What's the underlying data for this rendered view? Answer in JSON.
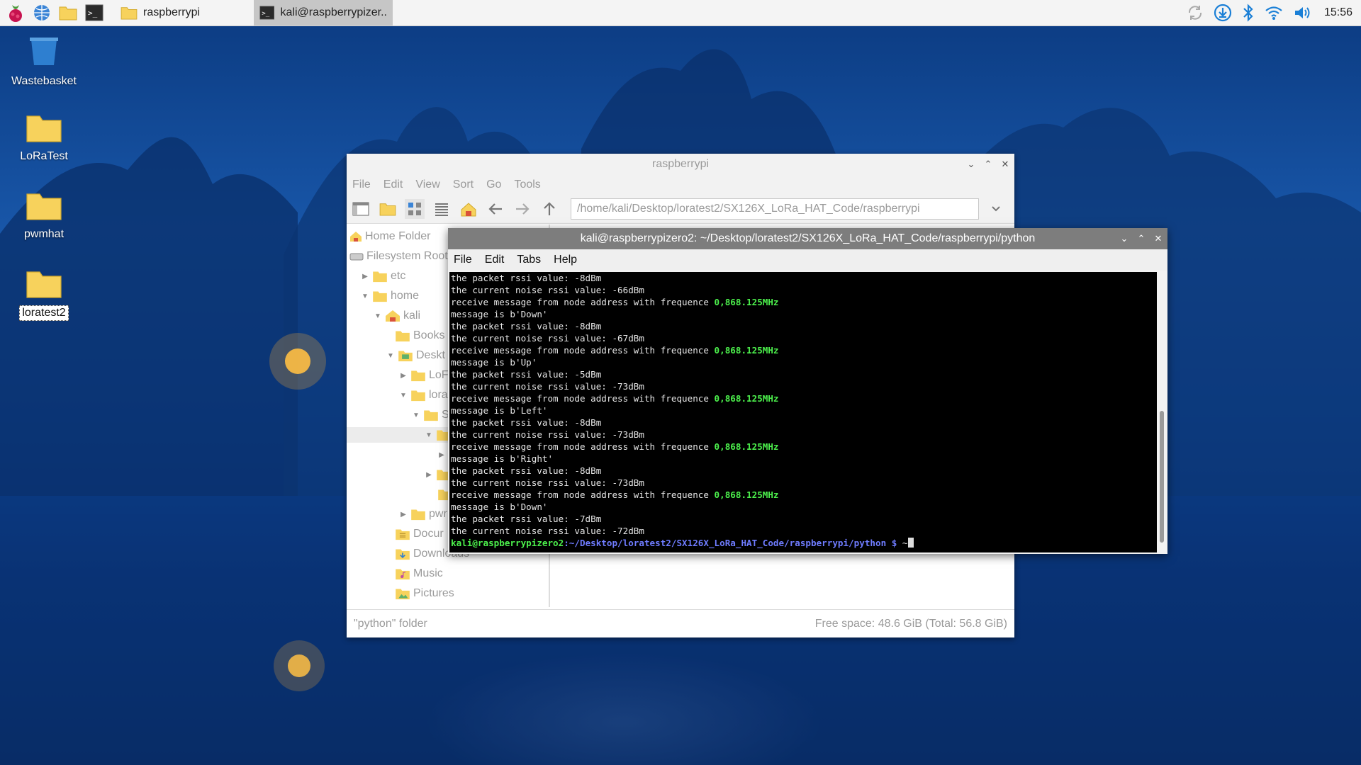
{
  "taskbar": {
    "tasks": [
      {
        "label": "raspberrypi",
        "active": false
      },
      {
        "label": "kali@raspberrypizer..",
        "active": true
      }
    ],
    "clock": "15:56"
  },
  "desktop": {
    "icons": [
      {
        "label": "Wastebasket"
      },
      {
        "label": "LoRaTest"
      },
      {
        "label": "pwmhat"
      },
      {
        "label": "loratest2"
      }
    ]
  },
  "file_manager": {
    "title": "raspberrypi",
    "menu": [
      "File",
      "Edit",
      "View",
      "Sort",
      "Go",
      "Tools"
    ],
    "path": "/home/kali/Desktop/loratest2/SX126X_LoRa_HAT_Code/raspberrypi",
    "places": [
      "Home Folder",
      "Filesystem Root"
    ],
    "tree": [
      "etc",
      "home",
      "kali",
      "Books",
      "Deskt",
      "LoF",
      "lora",
      "S",
      "pwr",
      "Docur",
      "Downloads",
      "Music",
      "Pictures"
    ],
    "status_left": "\"python\" folder",
    "status_right": "Free space: 48.6 GiB (Total: 56.8 GiB)"
  },
  "terminal": {
    "title": "kali@raspberrypizero2: ~/Desktop/loratest2/SX126X_LoRa_HAT_Code/raspberrypi/python",
    "menu": [
      "File",
      "Edit",
      "Tabs",
      "Help"
    ],
    "lines": [
      {
        "text": "the packet rssi value: -8dBm",
        "hl": ""
      },
      {
        "text": "the current noise rssi value: -66dBm",
        "hl": ""
      },
      {
        "text": "receive message from node address with frequence ",
        "hl": "0,868.125MHz"
      },
      {
        "text": "message is b'Down'",
        "hl": ""
      },
      {
        "text": "the packet rssi value: -8dBm",
        "hl": ""
      },
      {
        "text": "the current noise rssi value: -67dBm",
        "hl": ""
      },
      {
        "text": "receive message from node address with frequence ",
        "hl": "0,868.125MHz"
      },
      {
        "text": "message is b'Up'",
        "hl": ""
      },
      {
        "text": "the packet rssi value: -5dBm",
        "hl": ""
      },
      {
        "text": "the current noise rssi value: -73dBm",
        "hl": ""
      },
      {
        "text": "receive message from node address with frequence ",
        "hl": "0,868.125MHz"
      },
      {
        "text": "message is b'Left'",
        "hl": ""
      },
      {
        "text": "the packet rssi value: -8dBm",
        "hl": ""
      },
      {
        "text": "the current noise rssi value: -73dBm",
        "hl": ""
      },
      {
        "text": "receive message from node address with frequence ",
        "hl": "0,868.125MHz"
      },
      {
        "text": "message is b'Right'",
        "hl": ""
      },
      {
        "text": "the packet rssi value: -8dBm",
        "hl": ""
      },
      {
        "text": "the current noise rssi value: -73dBm",
        "hl": ""
      },
      {
        "text": "receive message from node address with frequence ",
        "hl": "0,868.125MHz"
      },
      {
        "text": "message is b'Down'",
        "hl": ""
      },
      {
        "text": "the packet rssi value: -7dBm",
        "hl": ""
      },
      {
        "text": "the current noise rssi value: -72dBm",
        "hl": ""
      }
    ],
    "prompt_user": "kali@raspberrypizero2",
    "prompt_path": ":~/Desktop/loratest2/SX126X_LoRa_HAT_Code/raspberrypi/python $ ",
    "prompt_tail": "~"
  }
}
